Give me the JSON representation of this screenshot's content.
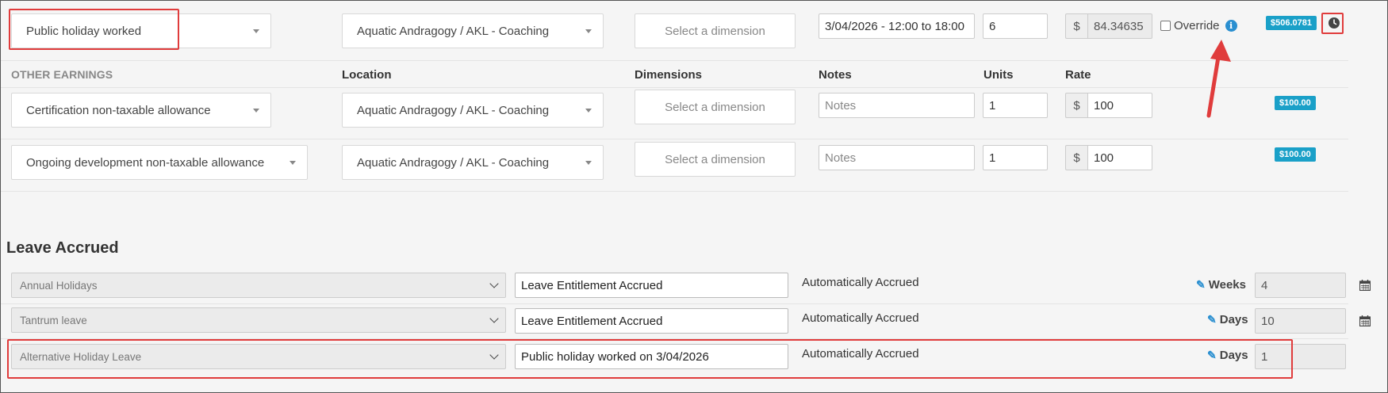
{
  "top_row": {
    "earning_type": "Public holiday worked",
    "location": "Aquatic Andragogy / AKL - Coaching",
    "dimension_placeholder": "Select a dimension",
    "notes": "3/04/2026 - 12:00 to 18:00",
    "units": "6",
    "currency": "$",
    "rate": "84.34635",
    "override_label": "Override",
    "total_badge": "$506.0781"
  },
  "other_earnings": {
    "section_label": "OTHER EARNINGS",
    "headers": {
      "location": "Location",
      "dimensions": "Dimensions",
      "notes": "Notes",
      "units": "Units",
      "rate": "Rate"
    },
    "rows": [
      {
        "earning_type": "Certification non-taxable allowance",
        "location": "Aquatic Andragogy / AKL - Coaching",
        "dimension_placeholder": "Select a dimension",
        "notes_placeholder": "Notes",
        "units": "1",
        "currency": "$",
        "rate": "100",
        "total_badge": "$100.00"
      },
      {
        "earning_type": "Ongoing development non-taxable allowance",
        "location": "Aquatic Andragogy / AKL - Coaching",
        "dimension_placeholder": "Select a dimension",
        "notes_placeholder": "Notes",
        "units": "1",
        "currency": "$",
        "rate": "100",
        "total_badge": "$100.00"
      }
    ]
  },
  "leave_accrued": {
    "title": "Leave Accrued",
    "rows": [
      {
        "leave_type": "Annual Holidays",
        "description": "Leave Entitlement Accrued",
        "status": "Automatically Accrued",
        "unit_label": "Weeks",
        "value": "4"
      },
      {
        "leave_type": "Tantrum leave",
        "description": "Leave Entitlement Accrued",
        "status": "Automatically Accrued",
        "unit_label": "Days",
        "value": "10"
      },
      {
        "leave_type": "Alternative Holiday Leave",
        "description": "Public holiday worked on 3/04/2026",
        "status": "Automatically Accrued",
        "unit_label": "Days",
        "value": "1"
      }
    ]
  },
  "colors": {
    "badge": "#1aa0c8",
    "annotation": "#e03c3c",
    "info_icon": "#2a8fd0"
  },
  "icons": {
    "select_caret": "caret-down-icon",
    "info": "info-icon",
    "clock": "clock-icon",
    "pencil": "pencil-icon",
    "calendar": "calendar-icon",
    "arrow": "annotation-arrow-icon"
  }
}
